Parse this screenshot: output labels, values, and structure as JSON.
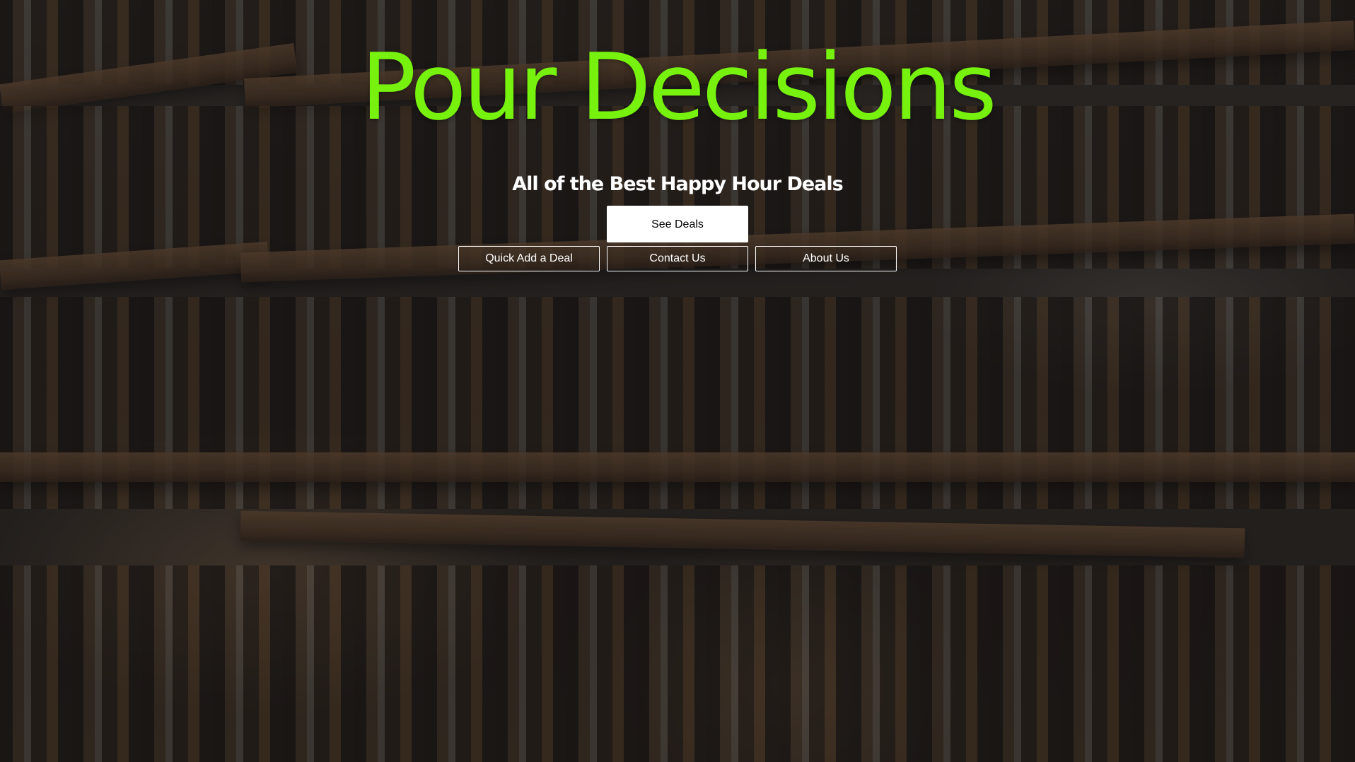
{
  "hero": {
    "title": "Pour Decisions",
    "tagline": "All of the Best Happy Hour Deals"
  },
  "buttons": {
    "see_deals": "See Deals",
    "quick_add": "Quick Add a Deal",
    "contact": "Contact Us",
    "about": "About Us"
  },
  "colors": {
    "title": "#77f20f",
    "primary_button_bg": "#ffffff",
    "text": "#ffffff"
  },
  "background": {
    "icon": "bar-shelves-photo"
  }
}
